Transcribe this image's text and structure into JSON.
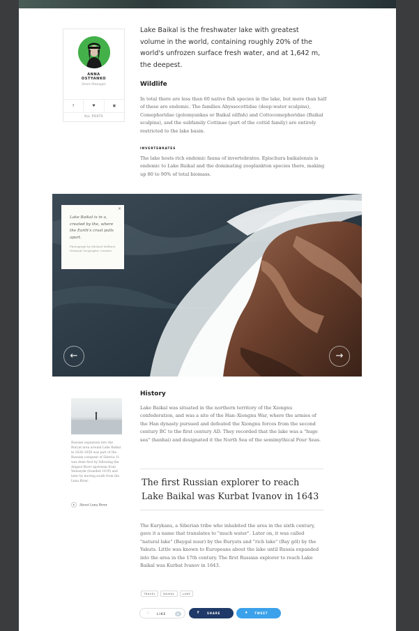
{
  "author": {
    "name": "ANNA\nOSTYANKO",
    "role": "Store Manager",
    "social": [
      "f",
      "♥",
      "▣"
    ],
    "all_posts": "ALL POSTS"
  },
  "lead": "Lake Baikal is the freshwater lake with greatest volume in the world, containing roughly 20% of the world's unfrozen surface fresh water, and at 1,642 m, the deepest.",
  "wildlife": {
    "heading": "Wildlife",
    "body": "In total there are less than 60 native fish species in the lake, but more than half of these are endemic. The families Abyssocottidae (deep-water sculpins), Comephoridae (golomyankas or Baikal oilfish) and Cottocomephoridae (Baikal sculpins), and the subfamily Cottinae (part of the cottid family) are entirely restricted to the lake basin."
  },
  "invertebrates": {
    "kicker": "INVERTEBRATES",
    "body": "The lake hosts rich endemic fauna of invertebrates. Epischura baikalensis is endemic to Lake Baikal and the dominating zooplankton species there, making up 80 to 90% of total biomass."
  },
  "photo": {
    "caption": "Lake Baikal is in a, created by the, where the Earth's crust pulls apart.",
    "credit": "Photograph by Michael Melford, National Geographic Creative",
    "close": "×",
    "prev": "←",
    "next": "→"
  },
  "history": {
    "heading": "History",
    "body": "Lake Baikal was situated in the northern territory of the Xiongnu confederation, and was a site of the Han–Xiongnu War, where the armies of the Han dynasty pursued and defeated the Xiongnu forces from the second century BC to the first century AD. They recorded that the lake was a \"huge sea\" (hanhai) and designated it the North Sea of the semimythical Four Seas."
  },
  "sidebar": {
    "text": "Russian expansion into the Buryat area around Lake Baikal in 1628–1658 was part of the Russian conquest of Siberia. It was done first by following the Angara River upstream from Yeniseysk (founded 1619) and later by moving south from the Lena River.",
    "link": "About Lena River"
  },
  "pull_quote": "The first Russian explorer to reach Lake Baikal was Kurbat Ivanov in 1643",
  "closing": "The Kurykans, a Siberian tribe who inhabited the area in the sixth century, gave it a name that translates to \"much water\". Later on, it was called \"natural lake\" (Baygal nuur) by the Buryats and \"rich lake\" (Bay göl) by the Yakuts. Little was known to Europeans about the lake until Russia expanded into the area in the 17th century. The first Russian explorer to reach Lake Baikal was Kurbat Ivanov in 1643.",
  "tags": [
    "TRAVEL",
    "BAIKAL",
    "LAKE"
  ],
  "actions": {
    "like_label": "LIKE",
    "like_count": "8",
    "share_label": "SHARE",
    "tweet_label": "TWEET"
  },
  "colors": {
    "share": "#1f3a68",
    "tweet": "#3ba1ea",
    "avatar_bg": "#43b04a"
  }
}
